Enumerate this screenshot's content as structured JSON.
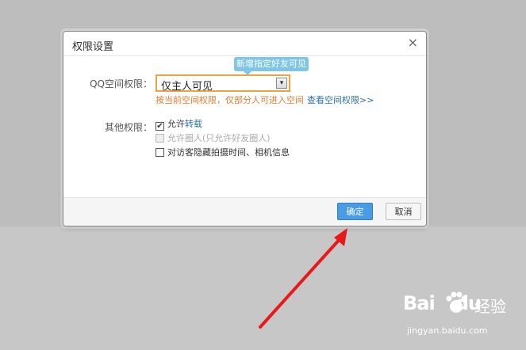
{
  "dialog": {
    "title": "权限设置",
    "close_glyph": "×",
    "qzone_label": "QQ空间权限：",
    "select_value": "仅主人可见",
    "select_arrow_glyph": "▾",
    "tooltip": "新增指定好友可见",
    "hint_warning": "按当前空间权限，仅部分人可进入空间",
    "hint_link": "查看空间权限>>",
    "other_label": "其他权限：",
    "options": [
      {
        "prefix": "允许",
        "highlight": "转载",
        "checked": true,
        "disabled": false
      },
      {
        "text": "允许圈人(只允许好友圈人)",
        "checked": false,
        "disabled": true
      },
      {
        "text": "对访客隐藏拍摄时间、相机信息",
        "checked": false,
        "disabled": false
      }
    ],
    "ok_label": "确定",
    "cancel_label": "取消"
  },
  "watermark": {
    "logo": "Bai",
    "logo2": "du",
    "text": "经验",
    "url": "jingyan.baidu.com"
  },
  "colors": {
    "accent_orange": "#f0a33c",
    "link_blue": "#2a6fb5",
    "ok_button": "#4a9be6",
    "annotation_arrow": "#e8191a"
  },
  "icons": {
    "close": "close-icon",
    "select_arrow": "chevron-down-icon",
    "checkbox_checked": "check-icon",
    "watermark_paw": "paw-icon"
  }
}
